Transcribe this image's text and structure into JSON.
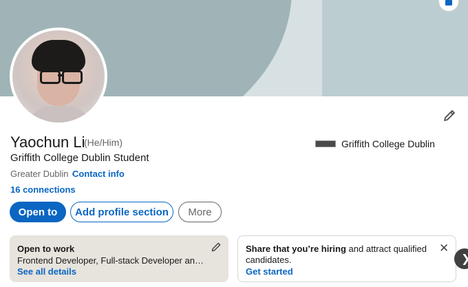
{
  "profile": {
    "name": "Yaochun Li",
    "pronouns": "(He/Him)",
    "headline": "Griffith College Dublin Student",
    "location": "Greater Dublin ·",
    "contact_info": "Contact info",
    "connections": "16 connections",
    "education": "Griffith College Dublin"
  },
  "actions": {
    "open_to": "Open to",
    "add_section": "Add profile section",
    "more": "More"
  },
  "cards": {
    "open_to_work": {
      "title": "Open to work",
      "roles": "Frontend Developer, Full-stack Developer and F...",
      "link": "See all details"
    },
    "hiring": {
      "bold": "Share that you’re hiring",
      "rest": " and attract qualified candidates.",
      "link": "Get started"
    }
  },
  "icons": {
    "edit": "pencil-icon",
    "camera": "camera-icon",
    "close": "close-icon",
    "next": "chevron-right-icon"
  },
  "colors": {
    "accent": "#0a66c2",
    "banner": "#a0b4b7",
    "card_bg": "#e7e3dd"
  }
}
